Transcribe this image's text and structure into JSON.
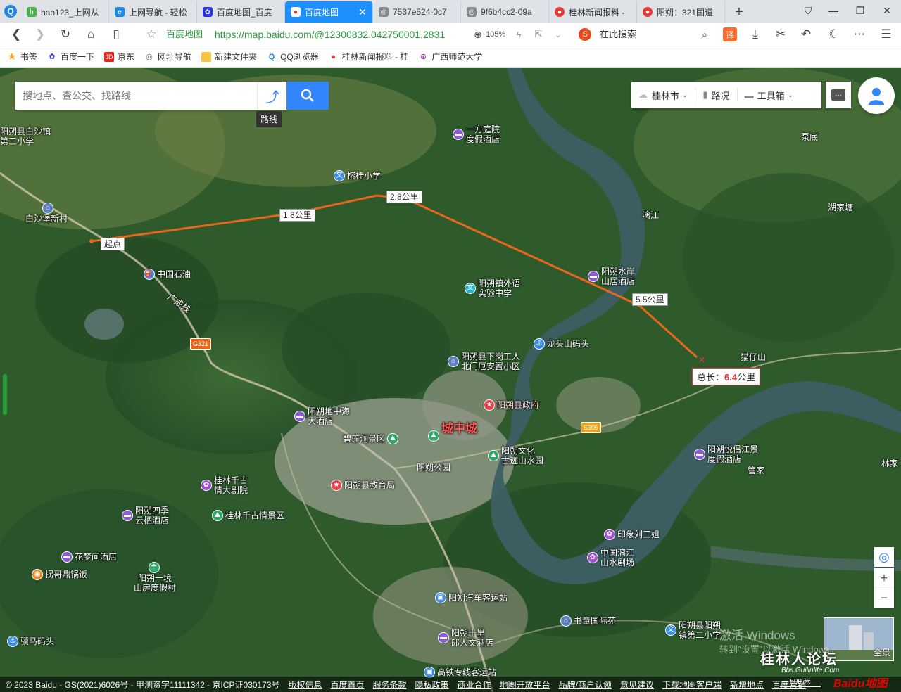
{
  "browser": {
    "tabs": [
      {
        "label": "hao123_上网从",
        "icon": "hao123-icon",
        "color": "#4caf50"
      },
      {
        "label": "上网导航 - 轻松",
        "icon": "ie-icon",
        "color": "#1e88e5"
      },
      {
        "label": "百度地图_百度",
        "icon": "baidu-paw-icon",
        "color": "#2932e1"
      },
      {
        "label": "百度地图",
        "icon": "map-pin-icon",
        "color": "#e53935"
      },
      {
        "label": "7537e524-0c7",
        "icon": "globe-icon",
        "color": "#777"
      },
      {
        "label": "9f6b4cc2-09a",
        "icon": "globe-icon",
        "color": "#777"
      },
      {
        "label": "桂林新闻报料 -",
        "icon": "guilin-icon",
        "color": "#e53935"
      },
      {
        "label": "阳朔：321国道",
        "icon": "guilin-icon",
        "color": "#e53935"
      }
    ],
    "active_tab": 3,
    "address": {
      "site": "百度地图",
      "url": "https://map.baidu.com/@12300832.042750001,2831",
      "zoom": "105%"
    },
    "search_engine_text": "在此搜索",
    "translate_label": "译",
    "bookmarks": [
      {
        "label": "书签",
        "icon": "star-icon"
      },
      {
        "label": "百度一下",
        "icon": "baidu-paw-icon"
      },
      {
        "label": "京东",
        "icon": "jd-icon"
      },
      {
        "label": "网址导航",
        "icon": "globe-icon"
      },
      {
        "label": "新建文件夹",
        "icon": "folder-icon"
      },
      {
        "label": "QQ浏览器",
        "icon": "qq-browser-icon"
      },
      {
        "label": "桂林新闻报料 - 桂",
        "icon": "guilin-icon"
      },
      {
        "label": "广西师范大学",
        "icon": "university-icon"
      }
    ]
  },
  "map": {
    "search_placeholder": "搜地点、查公交、找路线",
    "route_tip": "路线",
    "city": "桂林市",
    "traffic": "路况",
    "toolbox": "工具箱",
    "start_label": "起点",
    "distances": [
      "1.8公里",
      "2.8公里",
      "5.5公里"
    ],
    "total_prefix": "总长：",
    "total_value": "6.4",
    "total_unit": "公里",
    "pois": [
      {
        "label": "一方庭院\n度假酒店",
        "type": "hotel"
      },
      {
        "label": "榕桂小学",
        "type": "school"
      },
      {
        "label": "白沙堡新村",
        "type": "place"
      },
      {
        "label": "中国石油",
        "type": "gas"
      },
      {
        "label": "阳朔县白沙镇\n第三小学",
        "type": "text"
      },
      {
        "label": "阳朔镇外语\n实验中学",
        "type": "school"
      },
      {
        "label": "阳朔水岸\n山居酒店",
        "type": "hotel"
      },
      {
        "label": "龙头山码头",
        "type": "pier"
      },
      {
        "label": "阳朔县下岗工人\n北门厄安置小区",
        "type": "place"
      },
      {
        "label": "猫仔山",
        "type": "text"
      },
      {
        "label": "阳朔县政府",
        "type": "gov"
      },
      {
        "label": "阳朔地中海\n大酒店",
        "type": "hotel"
      },
      {
        "label": "碧莲洞景区",
        "type": "scenic"
      },
      {
        "label": "城中城",
        "type": "area"
      },
      {
        "label": "阳朔公园",
        "type": "scenic"
      },
      {
        "label": "阳朔文化\n古迹山水园",
        "type": "scenic"
      },
      {
        "label": "阳朔县教育局",
        "type": "gov"
      },
      {
        "label": "桂林千古\n情大剧院",
        "type": "theater"
      },
      {
        "label": "阳朔四季\n云栖酒店",
        "type": "hotel"
      },
      {
        "label": "桂林千古情景区",
        "type": "scenic"
      },
      {
        "label": "花梦间酒店",
        "type": "hotel"
      },
      {
        "label": "拐哥鼎锅饭",
        "type": "food"
      },
      {
        "label": "阳朔一境\n山房度假村",
        "type": "resort"
      },
      {
        "label": "阳朔悦侣江景\n度假酒店",
        "type": "hotel"
      },
      {
        "label": "印象刘三姐",
        "type": "theater"
      },
      {
        "label": "中国漓江\n山水剧场",
        "type": "theater"
      },
      {
        "label": "阳朔汽车客运站",
        "type": "bus"
      },
      {
        "label": "阳朔十里\n郎人文酒店",
        "type": "hotel"
      },
      {
        "label": "书童国际苑",
        "type": "place"
      },
      {
        "label": "阳朔县阳朔\n镇第二小学",
        "type": "school"
      },
      {
        "label": "高铁专线客运站",
        "type": "bus"
      },
      {
        "label": "骥马码头",
        "type": "pier"
      }
    ],
    "area_labels": [
      "漓江",
      "泵底",
      "湖家塘",
      "管家",
      "林家",
      "广成线",
      "G321",
      "S305"
    ],
    "zoom_in": "+",
    "zoom_out": "−",
    "panorama_label": "全景",
    "scale": "500 米",
    "watermark_line1": "激活 Windows",
    "watermark_line2": "转到\"设置\"以激活 Windows。",
    "forum_name": "桂林人论坛",
    "forum_url": "Bbs.Guilinlife.Com",
    "footer": [
      "© 2023 Baidu - GS(2021)6026号 - 甲测资字11111342 - 京ICP证030173号",
      "版权信息",
      "百度首页",
      "服务条款",
      "隐私政策",
      "商业合作",
      "地图开放平台",
      "品牌/商户认领",
      "意见建议",
      "下载地图客户端",
      "新增地点",
      "百度营销"
    ],
    "brand": "Baidu地图"
  },
  "colors": {
    "route": "#e8671c",
    "accent": "#3385ff",
    "active_tab": "#1e8fff"
  }
}
